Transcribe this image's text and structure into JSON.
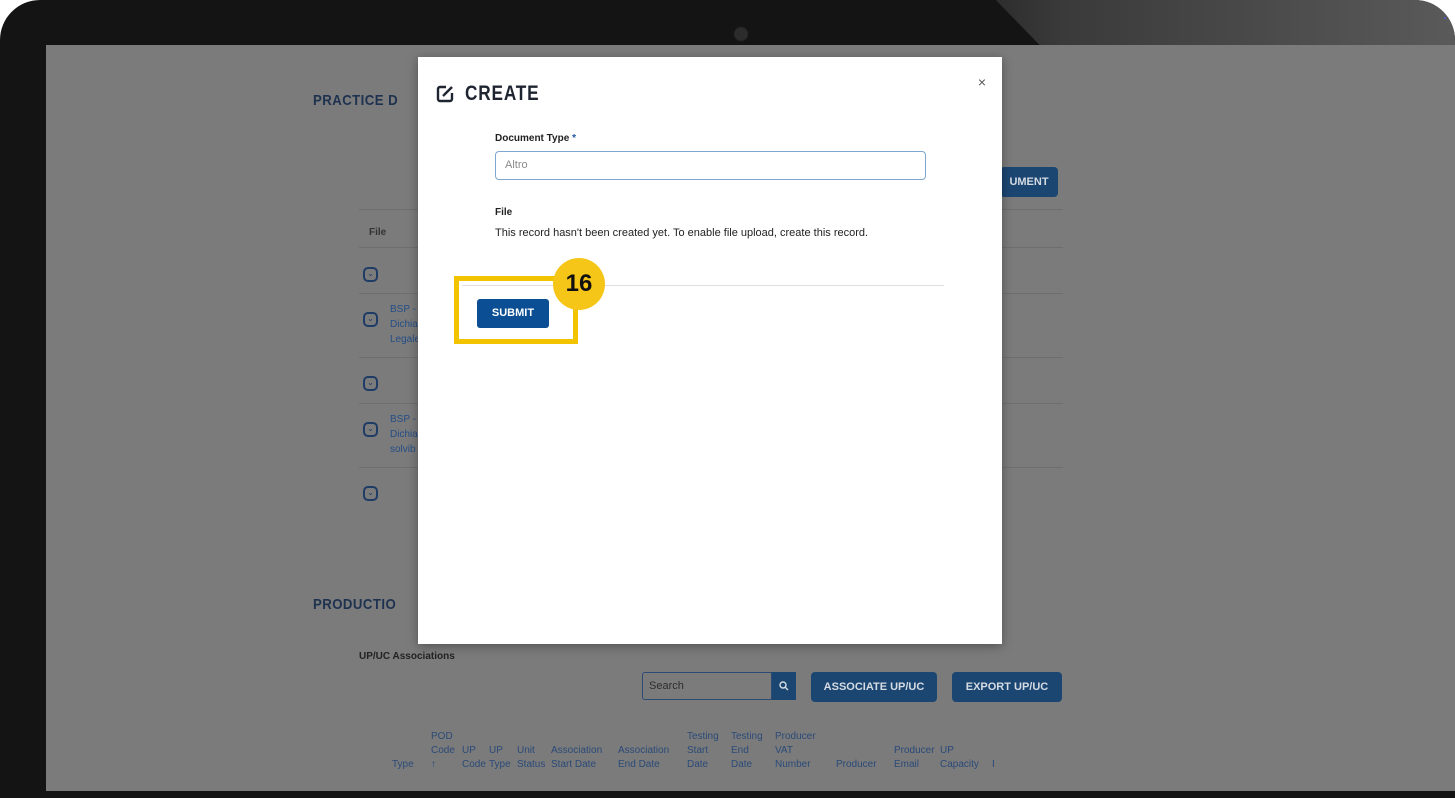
{
  "background_app": {
    "practice_section_title": "PRACTICE D",
    "add_document_button_fragment": "UMENT",
    "file_column_header": "File",
    "rows": [
      {
        "link_lines": []
      },
      {
        "link_lines": [
          "BSP -",
          "Dichia",
          "Legale"
        ]
      },
      {
        "link_lines": []
      },
      {
        "link_lines": [
          "BSP -",
          "Dichia",
          "solvib"
        ]
      },
      {
        "link_lines": []
      }
    ],
    "production_section_title": "PRODUCTIO",
    "associations_label": "UP/UC Associations",
    "search_placeholder": "Search",
    "associate_button": "ASSOCIATE UP/UC",
    "export_button": "EXPORT UP/UC",
    "table_headers": [
      {
        "lines": [
          "Type"
        ]
      },
      {
        "lines": [
          "POD",
          "Code",
          "↑"
        ]
      },
      {
        "lines": [
          "UP",
          "Code"
        ]
      },
      {
        "lines": [
          "UP",
          "Type"
        ]
      },
      {
        "lines": [
          "Unit",
          "Status"
        ]
      },
      {
        "lines": [
          "Association",
          "Start Date"
        ]
      },
      {
        "lines": [
          "Association",
          "End Date"
        ]
      },
      {
        "lines": [
          "Testing",
          "Start",
          "Date"
        ]
      },
      {
        "lines": [
          "Testing",
          "End",
          "Date"
        ]
      },
      {
        "lines": [
          "Producer",
          "VAT",
          "Number"
        ]
      },
      {
        "lines": [
          "Producer"
        ]
      },
      {
        "lines": [
          "Producer",
          "Email"
        ]
      },
      {
        "lines": [
          "UP",
          "Capacity"
        ]
      },
      {
        "lines": [
          "I"
        ]
      }
    ]
  },
  "modal": {
    "title": "CREATE",
    "close_symbol": "×",
    "document_type_label": "Document Type",
    "required_marker": "*",
    "document_type_value": "Altro",
    "file_label": "File",
    "file_note": "This record hasn't been created yet. To enable file upload, create this record.",
    "submit_label": "SUBMIT"
  },
  "tutorial": {
    "step_number": "16"
  },
  "colors": {
    "accent_blue": "#0b4e93",
    "highlight_yellow": "#f2c400",
    "overlay_gray": "#7b7b7b"
  }
}
